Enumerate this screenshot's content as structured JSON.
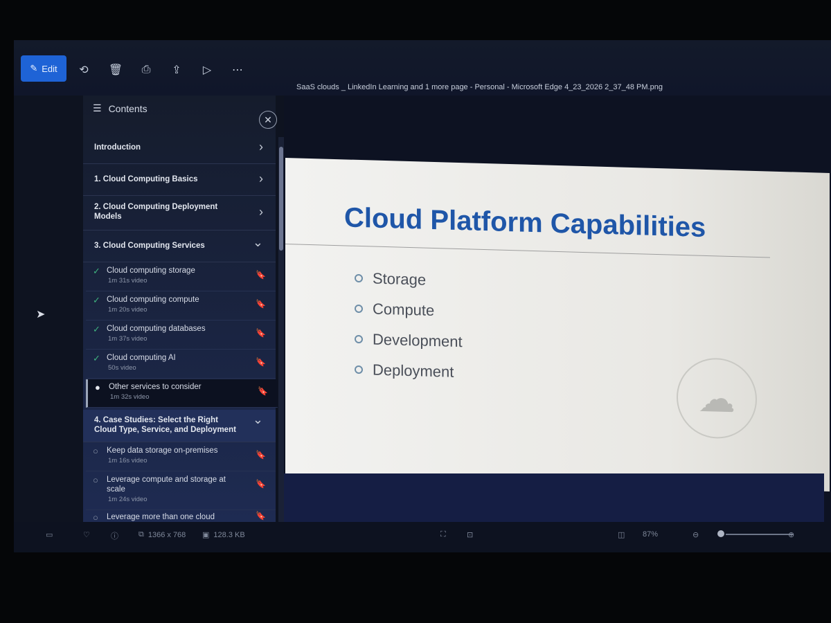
{
  "toolbar": {
    "edit_label": "Edit",
    "icons": [
      "lasso-icon",
      "delete-icon",
      "print-icon",
      "share-icon",
      "slideshow-icon",
      "more-icon"
    ],
    "file_title": "SaaS clouds _ LinkedIn Learning and 1 more page - Personal - Microsoft Edge 4_23_2026 2_37_48 PM.png"
  },
  "sidebar": {
    "title": "Contents",
    "sections": [
      {
        "label": "Introduction",
        "chevron": "›"
      },
      {
        "label": "1. Cloud Computing Basics",
        "chevron": "›"
      },
      {
        "label": "2. Cloud Computing Deployment Models",
        "chevron": "›"
      },
      {
        "label": "3. Cloud Computing Services",
        "chevron": "⌄"
      },
      {
        "label": "4. Case Studies: Select the Right Cloud Type, Service, and Deployment",
        "chevron": "⌄"
      }
    ],
    "items": [
      {
        "title": "Cloud computing storage",
        "duration": "1m 31s video",
        "status": "done"
      },
      {
        "title": "Cloud computing compute",
        "duration": "1m 20s video",
        "status": "done"
      },
      {
        "title": "Cloud computing databases",
        "duration": "1m 37s video",
        "status": "done"
      },
      {
        "title": "Cloud computing AI",
        "duration": "50s video",
        "status": "done"
      },
      {
        "title": "Other services to consider",
        "duration": "1m 32s video",
        "status": "current"
      },
      {
        "title": "Keep data storage on-premises",
        "duration": "1m 16s video",
        "status": "todo"
      },
      {
        "title": "Leverage compute and storage at scale",
        "duration": "1m 24s video",
        "status": "todo"
      },
      {
        "title": "Leverage more than one cloud",
        "duration": "",
        "status": "todo"
      }
    ]
  },
  "slide": {
    "title": "Cloud Platform Capabilities",
    "bullets": [
      "Storage",
      "Compute",
      "Development",
      "Deployment"
    ]
  },
  "statusbar": {
    "dimensions": "1366 x 768",
    "file_size": "128.3 KB",
    "zoom": "87%"
  },
  "colors": {
    "accent": "#1e63d6",
    "slide_title": "#1f56a8",
    "check": "#3fb37f"
  }
}
